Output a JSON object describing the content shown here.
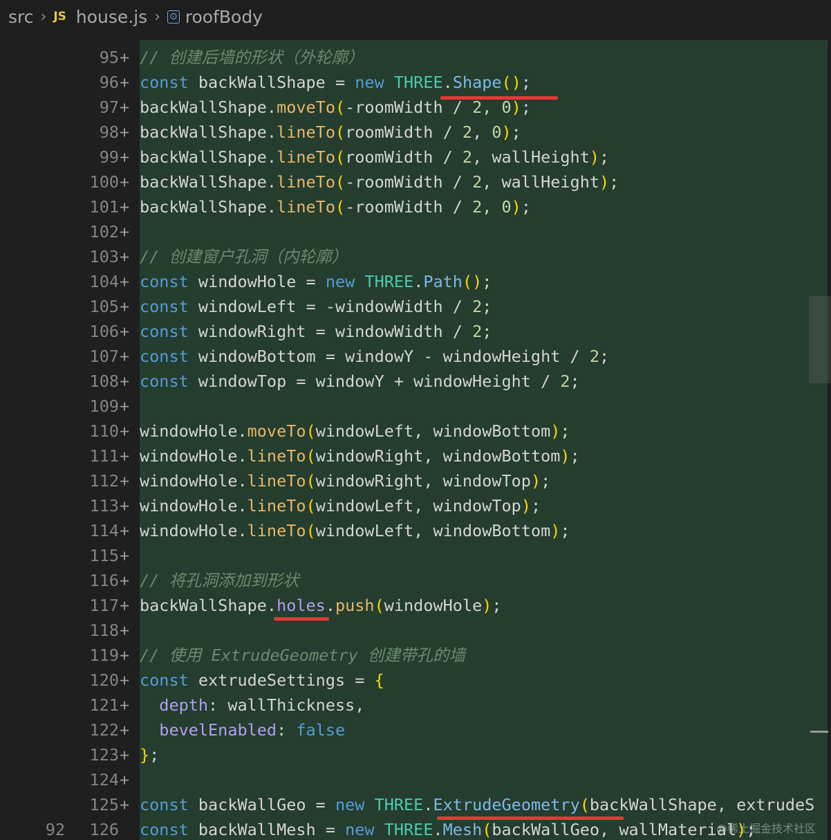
{
  "breadcrumb": {
    "folder": "src",
    "file_icon": "JS",
    "file": "house.js",
    "symbol": "roofBody"
  },
  "lines": [
    {
      "n": "95",
      "tokens": [
        [
          "cmt",
          "// 创建后墙的形状（外轮廓）"
        ]
      ]
    },
    {
      "n": "96",
      "tokens": [
        [
          "kw",
          "const"
        ],
        [
          "var",
          " backWallShape = "
        ],
        [
          "kw",
          "new"
        ],
        [
          "var",
          " "
        ],
        [
          "typ",
          "THREE"
        ],
        [
          "var",
          "."
        ],
        [
          "cls",
          "Shape"
        ],
        [
          "br",
          "()"
        ],
        [
          "var",
          ";"
        ]
      ]
    },
    {
      "n": "97",
      "tokens": [
        [
          "var",
          "backWallShape."
        ],
        [
          "fnc",
          "moveTo"
        ],
        [
          "br",
          "("
        ],
        [
          "var",
          "-roomWidth / "
        ],
        [
          "num",
          "2"
        ],
        [
          "var",
          ", "
        ],
        [
          "num",
          "0"
        ],
        [
          "br",
          ")"
        ],
        [
          "var",
          ";"
        ]
      ]
    },
    {
      "n": "98",
      "tokens": [
        [
          "var",
          "backWallShape."
        ],
        [
          "fnc",
          "lineTo"
        ],
        [
          "br",
          "("
        ],
        [
          "var",
          "roomWidth / "
        ],
        [
          "num",
          "2"
        ],
        [
          "var",
          ", "
        ],
        [
          "num",
          "0"
        ],
        [
          "br",
          ")"
        ],
        [
          "var",
          ";"
        ]
      ]
    },
    {
      "n": "99",
      "tokens": [
        [
          "var",
          "backWallShape."
        ],
        [
          "fnc",
          "lineTo"
        ],
        [
          "br",
          "("
        ],
        [
          "var",
          "roomWidth / "
        ],
        [
          "num",
          "2"
        ],
        [
          "var",
          ", wallHeight"
        ],
        [
          "br",
          ")"
        ],
        [
          "var",
          ";"
        ]
      ]
    },
    {
      "n": "100",
      "tokens": [
        [
          "var",
          "backWallShape."
        ],
        [
          "fnc",
          "lineTo"
        ],
        [
          "br",
          "("
        ],
        [
          "var",
          "-roomWidth / "
        ],
        [
          "num",
          "2"
        ],
        [
          "var",
          ", wallHeight"
        ],
        [
          "br",
          ")"
        ],
        [
          "var",
          ";"
        ]
      ]
    },
    {
      "n": "101",
      "tokens": [
        [
          "var",
          "backWallShape."
        ],
        [
          "fnc",
          "lineTo"
        ],
        [
          "br",
          "("
        ],
        [
          "var",
          "-roomWidth / "
        ],
        [
          "num",
          "2"
        ],
        [
          "var",
          ", "
        ],
        [
          "num",
          "0"
        ],
        [
          "br",
          ")"
        ],
        [
          "var",
          ";"
        ]
      ]
    },
    {
      "n": "102",
      "tokens": []
    },
    {
      "n": "103",
      "tokens": [
        [
          "cmt",
          "// 创建窗户孔洞（内轮廓）"
        ]
      ]
    },
    {
      "n": "104",
      "tokens": [
        [
          "kw",
          "const"
        ],
        [
          "var",
          " windowHole = "
        ],
        [
          "kw",
          "new"
        ],
        [
          "var",
          " "
        ],
        [
          "typ",
          "THREE"
        ],
        [
          "var",
          "."
        ],
        [
          "cls",
          "Path"
        ],
        [
          "br",
          "()"
        ],
        [
          "var",
          ";"
        ]
      ]
    },
    {
      "n": "105",
      "tokens": [
        [
          "kw",
          "const"
        ],
        [
          "var",
          " windowLeft = -windowWidth / "
        ],
        [
          "num",
          "2"
        ],
        [
          "var",
          ";"
        ]
      ]
    },
    {
      "n": "106",
      "tokens": [
        [
          "kw",
          "const"
        ],
        [
          "var",
          " windowRight = windowWidth / "
        ],
        [
          "num",
          "2"
        ],
        [
          "var",
          ";"
        ]
      ]
    },
    {
      "n": "107",
      "tokens": [
        [
          "kw",
          "const"
        ],
        [
          "var",
          " windowBottom = windowY - windowHeight / "
        ],
        [
          "num",
          "2"
        ],
        [
          "var",
          ";"
        ]
      ]
    },
    {
      "n": "108",
      "tokens": [
        [
          "kw",
          "const"
        ],
        [
          "var",
          " windowTop = windowY + windowHeight / "
        ],
        [
          "num",
          "2"
        ],
        [
          "var",
          ";"
        ]
      ]
    },
    {
      "n": "109",
      "tokens": []
    },
    {
      "n": "110",
      "tokens": [
        [
          "var",
          "windowHole."
        ],
        [
          "fnc",
          "moveTo"
        ],
        [
          "br",
          "("
        ],
        [
          "var",
          "windowLeft, windowBottom"
        ],
        [
          "br",
          ")"
        ],
        [
          "var",
          ";"
        ]
      ]
    },
    {
      "n": "111",
      "tokens": [
        [
          "var",
          "windowHole."
        ],
        [
          "fnc",
          "lineTo"
        ],
        [
          "br",
          "("
        ],
        [
          "var",
          "windowRight, windowBottom"
        ],
        [
          "br",
          ")"
        ],
        [
          "var",
          ";"
        ]
      ]
    },
    {
      "n": "112",
      "tokens": [
        [
          "var",
          "windowHole."
        ],
        [
          "fnc",
          "lineTo"
        ],
        [
          "br",
          "("
        ],
        [
          "var",
          "windowRight, windowTop"
        ],
        [
          "br",
          ")"
        ],
        [
          "var",
          ";"
        ]
      ]
    },
    {
      "n": "113",
      "tokens": [
        [
          "var",
          "windowHole."
        ],
        [
          "fnc",
          "lineTo"
        ],
        [
          "br",
          "("
        ],
        [
          "var",
          "windowLeft, windowTop"
        ],
        [
          "br",
          ")"
        ],
        [
          "var",
          ";"
        ]
      ]
    },
    {
      "n": "114",
      "tokens": [
        [
          "var",
          "windowHole."
        ],
        [
          "fnc",
          "lineTo"
        ],
        [
          "br",
          "("
        ],
        [
          "var",
          "windowLeft, windowBottom"
        ],
        [
          "br",
          ")"
        ],
        [
          "var",
          ";"
        ]
      ]
    },
    {
      "n": "115",
      "tokens": []
    },
    {
      "n": "116",
      "tokens": [
        [
          "cmt",
          "// 将孔洞添加到形状"
        ]
      ]
    },
    {
      "n": "117",
      "tokens": [
        [
          "var",
          "backWallShape."
        ],
        [
          "prop",
          "holes"
        ],
        [
          "var",
          "."
        ],
        [
          "fnc",
          "push"
        ],
        [
          "br",
          "("
        ],
        [
          "var",
          "windowHole"
        ],
        [
          "br",
          ")"
        ],
        [
          "var",
          ";"
        ]
      ]
    },
    {
      "n": "118",
      "tokens": []
    },
    {
      "n": "119",
      "tokens": [
        [
          "cmt",
          "// 使用 ExtrudeGeometry 创建带孔的墙"
        ]
      ]
    },
    {
      "n": "120",
      "tokens": [
        [
          "kw",
          "const"
        ],
        [
          "var",
          " extrudeSettings = "
        ],
        [
          "br",
          "{"
        ]
      ]
    },
    {
      "n": "121",
      "tokens": [
        [
          "var",
          "  "
        ],
        [
          "prop",
          "depth"
        ],
        [
          "var",
          ": wallThickness,"
        ]
      ]
    },
    {
      "n": "122",
      "tokens": [
        [
          "var",
          "  "
        ],
        [
          "prop",
          "bevelEnabled"
        ],
        [
          "var",
          ": "
        ],
        [
          "kw",
          "false"
        ]
      ]
    },
    {
      "n": "123",
      "tokens": [
        [
          "br",
          "}"
        ],
        [
          "var",
          ";"
        ]
      ]
    },
    {
      "n": "124",
      "tokens": []
    },
    {
      "n": "125",
      "tokens": [
        [
          "kw",
          "const"
        ],
        [
          "var",
          " backWallGeo = "
        ],
        [
          "kw",
          "new"
        ],
        [
          "var",
          " "
        ],
        [
          "typ",
          "THREE"
        ],
        [
          "var",
          "."
        ],
        [
          "cls",
          "ExtrudeGeometry"
        ],
        [
          "br",
          "("
        ],
        [
          "var",
          "backWallShape, extrudeS"
        ]
      ]
    },
    {
      "n": "126",
      "n_alt": "92",
      "tokens": [
        [
          "kw",
          "const"
        ],
        [
          "var",
          " backWallMesh = "
        ],
        [
          "kw",
          "new"
        ],
        [
          "var",
          " "
        ],
        [
          "typ",
          "THREE"
        ],
        [
          "var",
          "."
        ],
        [
          "cls",
          "Mesh"
        ],
        [
          "br",
          "("
        ],
        [
          "var",
          "backWallGeo, wallMaterial"
        ],
        [
          "br",
          ")"
        ],
        [
          "var",
          ";"
        ]
      ]
    }
  ],
  "plus_sign": "+",
  "watermark": "@稀土掘金技术社区",
  "colors": {
    "diff_added_bg": "#243d2e",
    "editor_bg": "#1f1f1f",
    "annotation_red": "#e53935"
  }
}
